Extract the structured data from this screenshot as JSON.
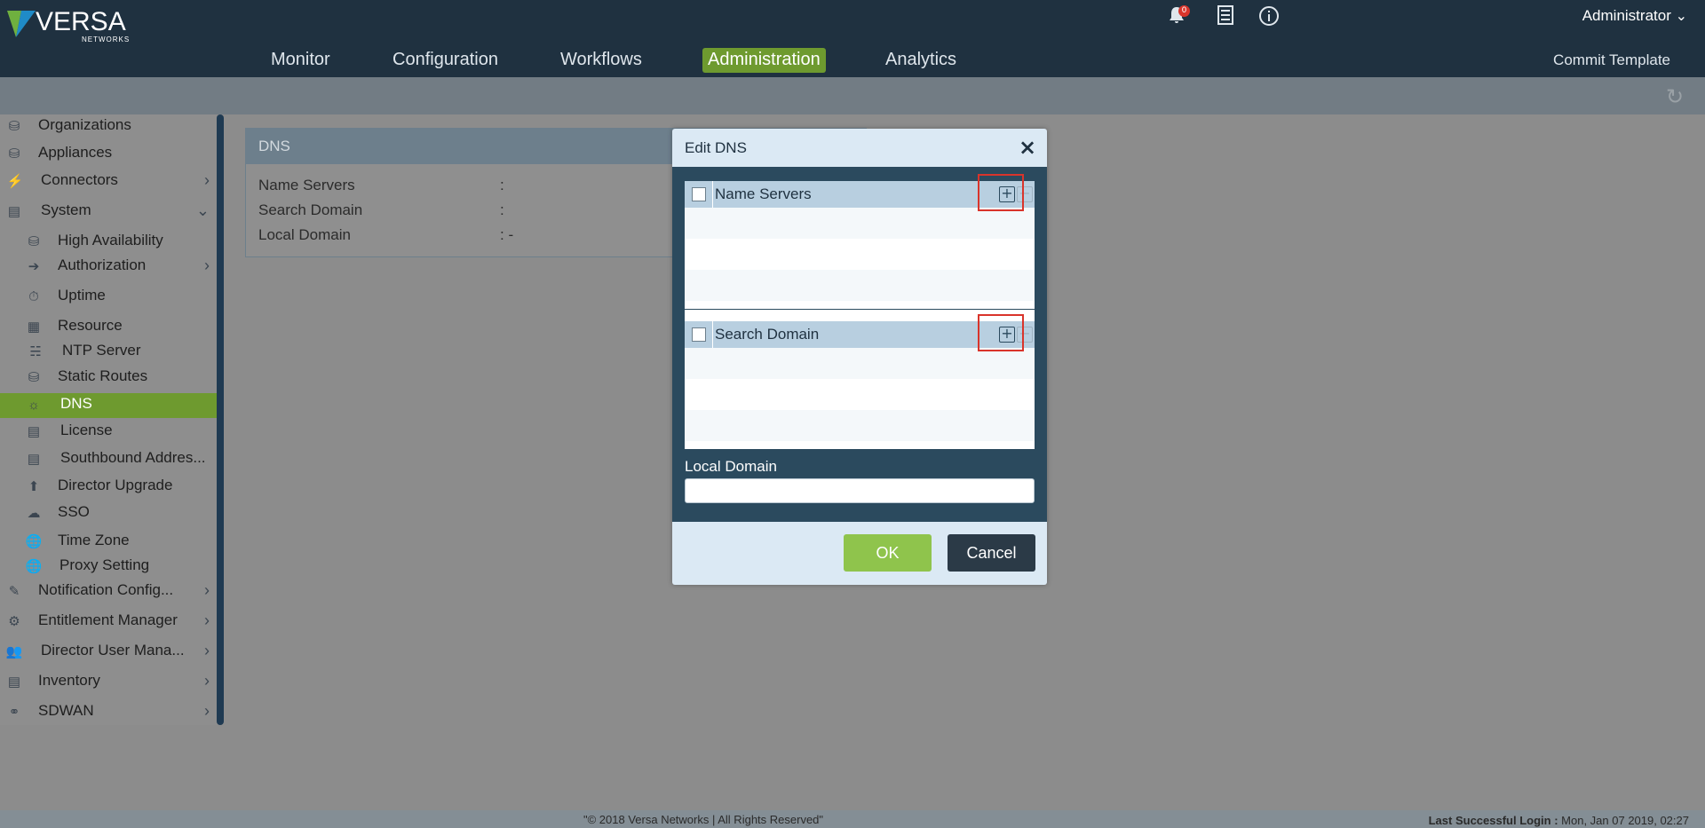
{
  "app": {
    "logo_text": "VERSA",
    "logo_sub": "NETWORKS",
    "notification_count": "0",
    "user": "Administrator",
    "commit_label": "Commit Template"
  },
  "nav": [
    {
      "label": "Monitor"
    },
    {
      "label": "Configuration"
    },
    {
      "label": "Workflows"
    },
    {
      "label": "Administration"
    },
    {
      "label": "Analytics"
    }
  ],
  "sidebar": {
    "items": [
      {
        "label": "Organizations",
        "icon": "organizations-icon"
      },
      {
        "label": "Appliances",
        "icon": "appliances-icon"
      },
      {
        "label": "Connectors",
        "icon": "connectors-icon"
      },
      {
        "label": "System",
        "icon": "system-icon"
      },
      {
        "label": "High Availability",
        "icon": "high-availability-icon"
      },
      {
        "label": "Authorization",
        "icon": "authorization-icon"
      },
      {
        "label": "Uptime",
        "icon": "uptime-icon"
      },
      {
        "label": "Resource",
        "icon": "resource-icon"
      },
      {
        "label": "NTP Server",
        "icon": "ntp-server-icon"
      },
      {
        "label": "Static Routes",
        "icon": "static-routes-icon"
      },
      {
        "label": "DNS",
        "icon": "dns-icon"
      },
      {
        "label": "License",
        "icon": "license-icon"
      },
      {
        "label": "Southbound Addres...",
        "icon": "southbound-address-icon"
      },
      {
        "label": "Director Upgrade",
        "icon": "director-upgrade-icon"
      },
      {
        "label": "SSO",
        "icon": "sso-icon"
      },
      {
        "label": "Time Zone",
        "icon": "time-zone-icon"
      },
      {
        "label": "Proxy Setting",
        "icon": "proxy-setting-icon"
      },
      {
        "label": "Notification Config...",
        "icon": "notification-config-icon"
      },
      {
        "label": "Entitlement Manager",
        "icon": "entitlement-manager-icon"
      },
      {
        "label": "Director User Mana...",
        "icon": "director-user-management-icon"
      },
      {
        "label": "Inventory",
        "icon": "inventory-icon"
      },
      {
        "label": "SDWAN",
        "icon": "sdwan-icon"
      }
    ]
  },
  "dns_panel": {
    "title": "DNS",
    "rows": [
      {
        "label": "Name Servers",
        "value": ":"
      },
      {
        "label": "Search Domain",
        "value": ":"
      },
      {
        "label": "Local Domain",
        "value": ": -"
      }
    ]
  },
  "modal": {
    "title": "Edit DNS",
    "name_servers_label": "Name Servers",
    "search_domain_label": "Search Domain",
    "local_domain_label": "Local Domain",
    "local_domain_value": "",
    "ok_label": "OK",
    "cancel_label": "Cancel"
  },
  "footer": {
    "copyright": "\"© 2018 Versa Networks | All Rights Reserved\"",
    "login_label": "Last Successful Login :",
    "login_value": "Mon, Jan 07 2019, 02:27"
  },
  "colors": {
    "header_bg": "#1f3140",
    "active_nav": "#6e9a2f",
    "ok_button": "#8fc44c",
    "cancel_button": "#2b3a47",
    "highlight": "#d9342b"
  }
}
